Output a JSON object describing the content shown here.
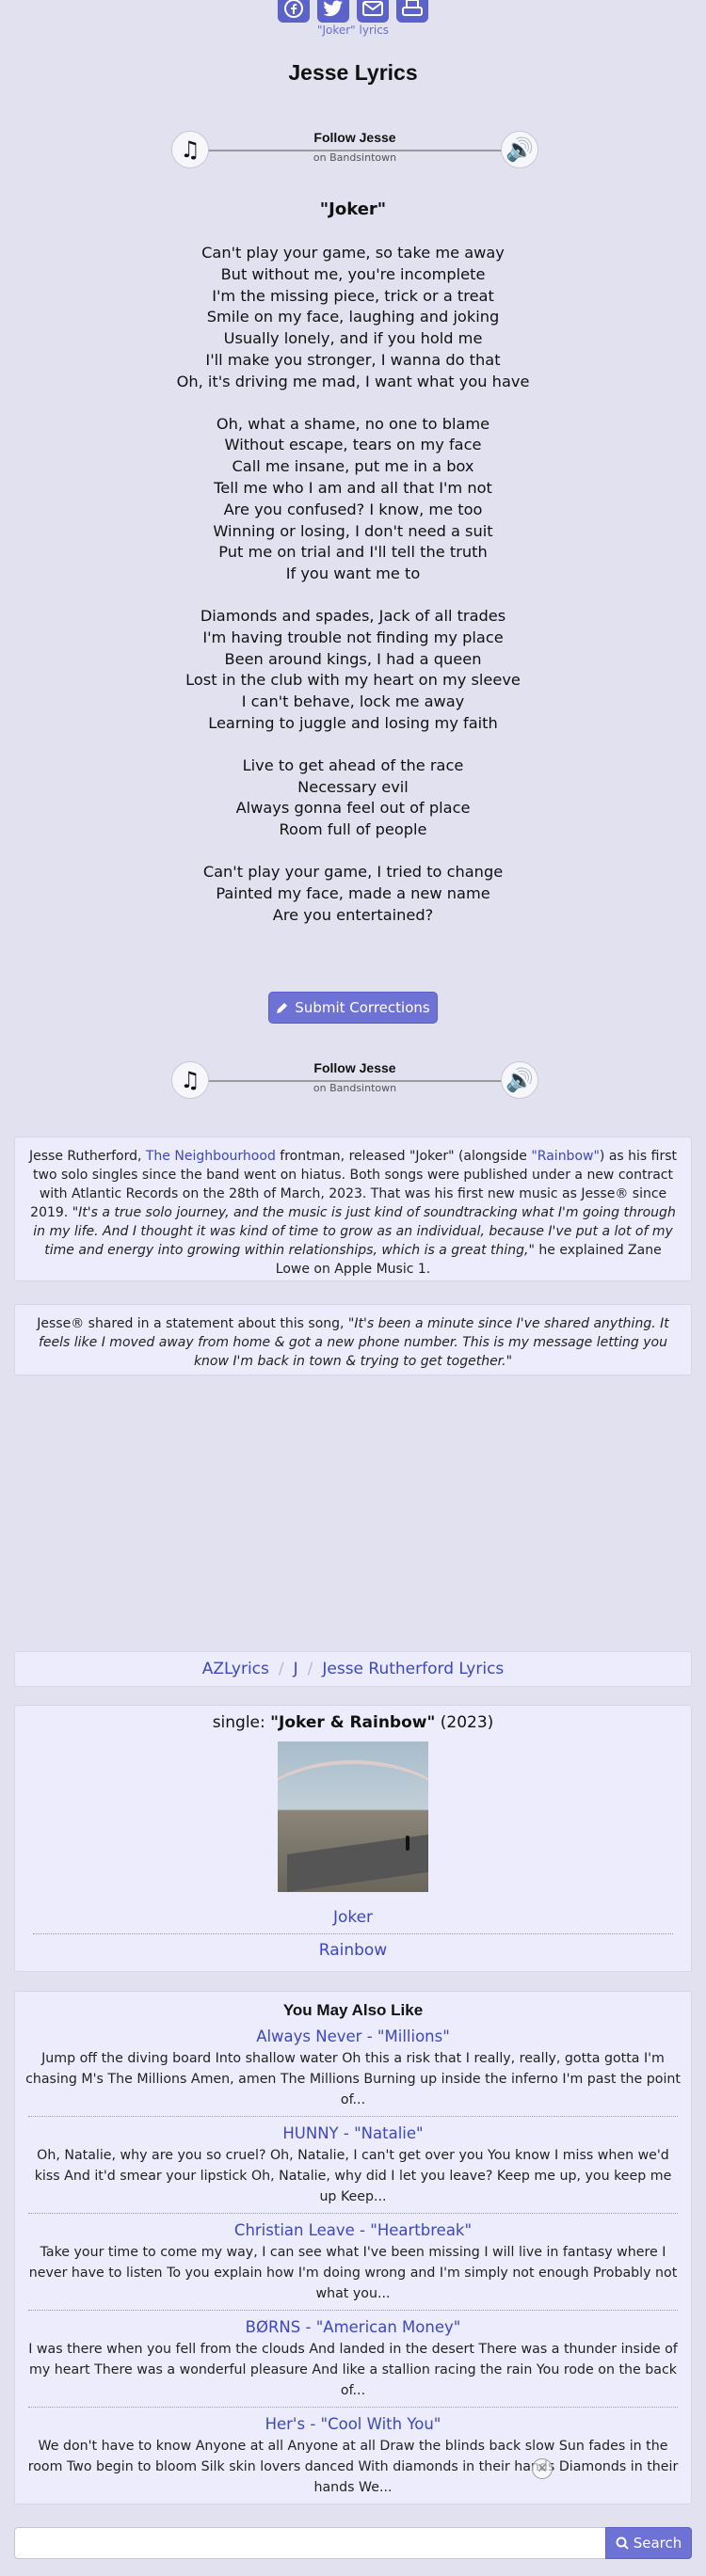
{
  "share": {
    "icons": [
      "facebook-icon",
      "twitter-icon",
      "email-icon",
      "print-icon"
    ],
    "caption": "\"Joker\" lyrics"
  },
  "page_title": "Jesse Lyrics",
  "follow": {
    "name": "Follow Jesse",
    "sub": "on Bandsintown"
  },
  "song_title": "\"Joker\"",
  "lyrics": [
    [
      "Can't play your game, so take me away",
      "But without me, you're incomplete",
      "I'm the missing piece, trick or a treat",
      "Smile on my face, laughing and joking",
      "Usually lonely, and if you hold me",
      "I'll make you stronger, I wanna do that",
      "Oh, it's driving me mad, I want what you have"
    ],
    [
      "Oh, what a shame, no one to blame",
      "Without escape, tears on my face",
      "Call me insane, put me in a box",
      "Tell me who I am and all that I'm not",
      "Are you confused? I know, me too",
      "Winning or losing, I don't need a suit",
      "Put me on trial and I'll tell the truth",
      "If you want me to"
    ],
    [
      "Diamonds and spades, Jack of all trades",
      "I'm having trouble not finding my place",
      "Been around kings, I had a queen",
      "Lost in the club with my heart on my sleeve",
      "I can't behave, lock me away",
      "Learning to juggle and losing my faith"
    ],
    [
      "Live to get ahead of the race",
      "Necessary evil",
      "Always gonna feel out of place",
      "Room full of people"
    ],
    [
      "Can't play your game, I tried to change",
      "Painted my face, made a new name",
      "Are you entertained?"
    ]
  ],
  "submit_corrections": "Submit Corrections",
  "info": {
    "p1_a": "Jesse Rutherford, ",
    "p1_link1": "The Neighbourhood",
    "p1_b": " frontman, released \"Joker\" (alongside ",
    "p1_link2": "\"Rainbow\"",
    "p1_c": ") as his first two solo singles since the band went on hiatus. Both songs were published under a new contract with Atlantic Records on the 28th of March, 2023. That was his first new music as Jesse® since 2019. ",
    "p1_quote": "\"It's a true solo journey, and the music is just kind of soundtracking what I'm going through in my life. And I thought it was kind of time to grow as an individual, because I've put a lot of my time and energy into growing within relationships, which is a great thing,\"",
    "p1_d": " he explained Zane Lowe on Apple Music 1.",
    "p2_a": "Jesse® shared in a statement about this song, ",
    "p2_quote": "\"It's been a minute since I've shared anything. It feels like I moved away from home & got a new phone number. This is my message letting you know I'm back in town & trying to get together.\""
  },
  "breadcrumb": {
    "home": "AZLyrics",
    "letter": "J",
    "artist": "Jesse Rutherford Lyrics"
  },
  "album": {
    "prefix": "single: ",
    "name": "\"Joker & Rainbow\"",
    "year": " (2023)",
    "tracks": [
      "Joker",
      "Rainbow"
    ]
  },
  "also": {
    "heading": "You May Also Like",
    "items": [
      {
        "title": "Always Never - \"Millions\"",
        "snippet": "Jump off the diving board Into shallow water Oh this a risk that I really, really, gotta gotta I'm chasing M's The Millions Amen, amen The Millions Burning up inside the inferno I'm past the point of..."
      },
      {
        "title": "HUNNY - \"Natalie\"",
        "snippet": "Oh, Natalie, why are you so cruel? Oh, Natalie, I can't get over you You know I miss when we'd kiss And it'd smear your lipstick Oh, Natalie, why did I let you leave? Keep me up, you keep me up Keep..."
      },
      {
        "title": "Christian Leave - \"Heartbreak\"",
        "snippet": "Take your time to come my way, I can see what I've been missing I will live in fantasy where I never have to listen To you explain how I'm doing wrong and I'm simply not enough Probably not what you..."
      },
      {
        "title": "BØRNS - \"American Money\"",
        "snippet": "I was there when you fell from the clouds And landed in the desert There was a thunder inside of my heart There was a wonderful pleasure And like a stallion racing the rain You rode on the back of..."
      },
      {
        "title": "Her's - \"Cool With You\"",
        "snippet": "We don't have to know Anyone at all Anyone at all Draw the blinds back slow Sun fades in the room Two begin to bloom Silk skin lovers danced With diamonds in their hands Diamonds in their hands We..."
      }
    ]
  },
  "search": {
    "placeholder": "",
    "button": "Search"
  }
}
